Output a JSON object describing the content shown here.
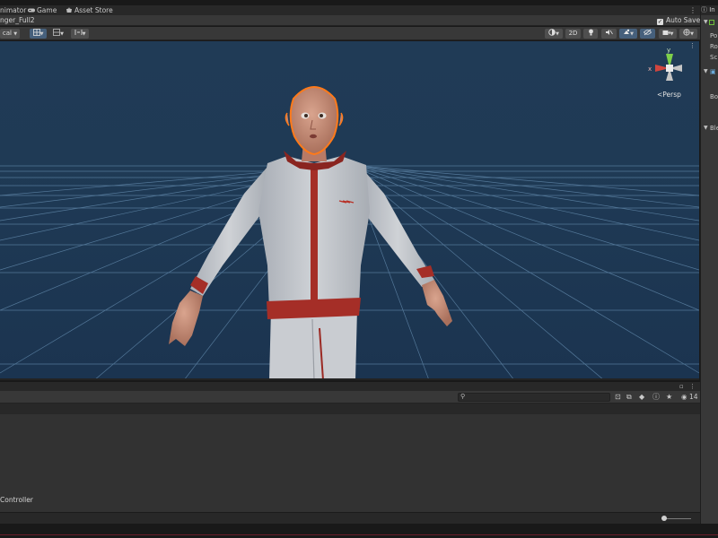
{
  "tabs": [
    {
      "label": "nimator",
      "icon": "animator-icon"
    },
    {
      "label": "Game",
      "icon": "game-controller-icon"
    },
    {
      "label": "Asset Store",
      "icon": "asset-store-icon"
    }
  ],
  "scene": {
    "name": "nger_Full2",
    "auto_save_label": "Auto Save",
    "auto_save_checked": "✓"
  },
  "toolbar": {
    "pivot_label": "cal",
    "mode_2d_label": "2D"
  },
  "viewport": {
    "persp_label": "Persp",
    "gizmo": {
      "y_label": "y",
      "x_label": "x"
    },
    "colors": {
      "background": "#1f3852",
      "grid": "#5d83a5",
      "selection_outline": "#ff7a1a"
    }
  },
  "project_panel": {
    "count_label": "14",
    "search_placeholder": "",
    "list_item": "Controller"
  },
  "inspector": {
    "tab_label": "In",
    "rows": [
      "Po",
      "Ro",
      "Sc",
      "Bo",
      "Ble"
    ]
  },
  "menu_glyph": "⋮"
}
